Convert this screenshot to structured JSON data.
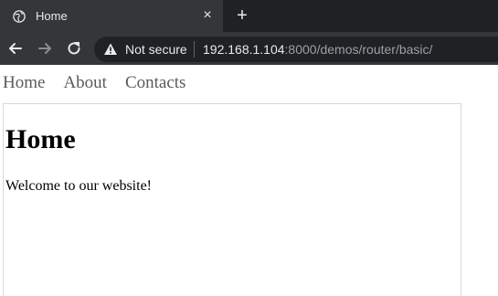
{
  "tab": {
    "title": "Home",
    "close_label": "×",
    "new_tab_label": "+"
  },
  "toolbar": {
    "security_label": "Not secure",
    "url_host": "192.168.1.104",
    "url_rest": ":8000/demos/router/basic/"
  },
  "page": {
    "nav": [
      "Home",
      "About",
      "Contacts"
    ],
    "heading": "Home",
    "text": "Welcome to our website!"
  },
  "colors": {
    "tabstrip": "#202124",
    "active_tab": "#35363a",
    "omnibox": "#202124"
  }
}
